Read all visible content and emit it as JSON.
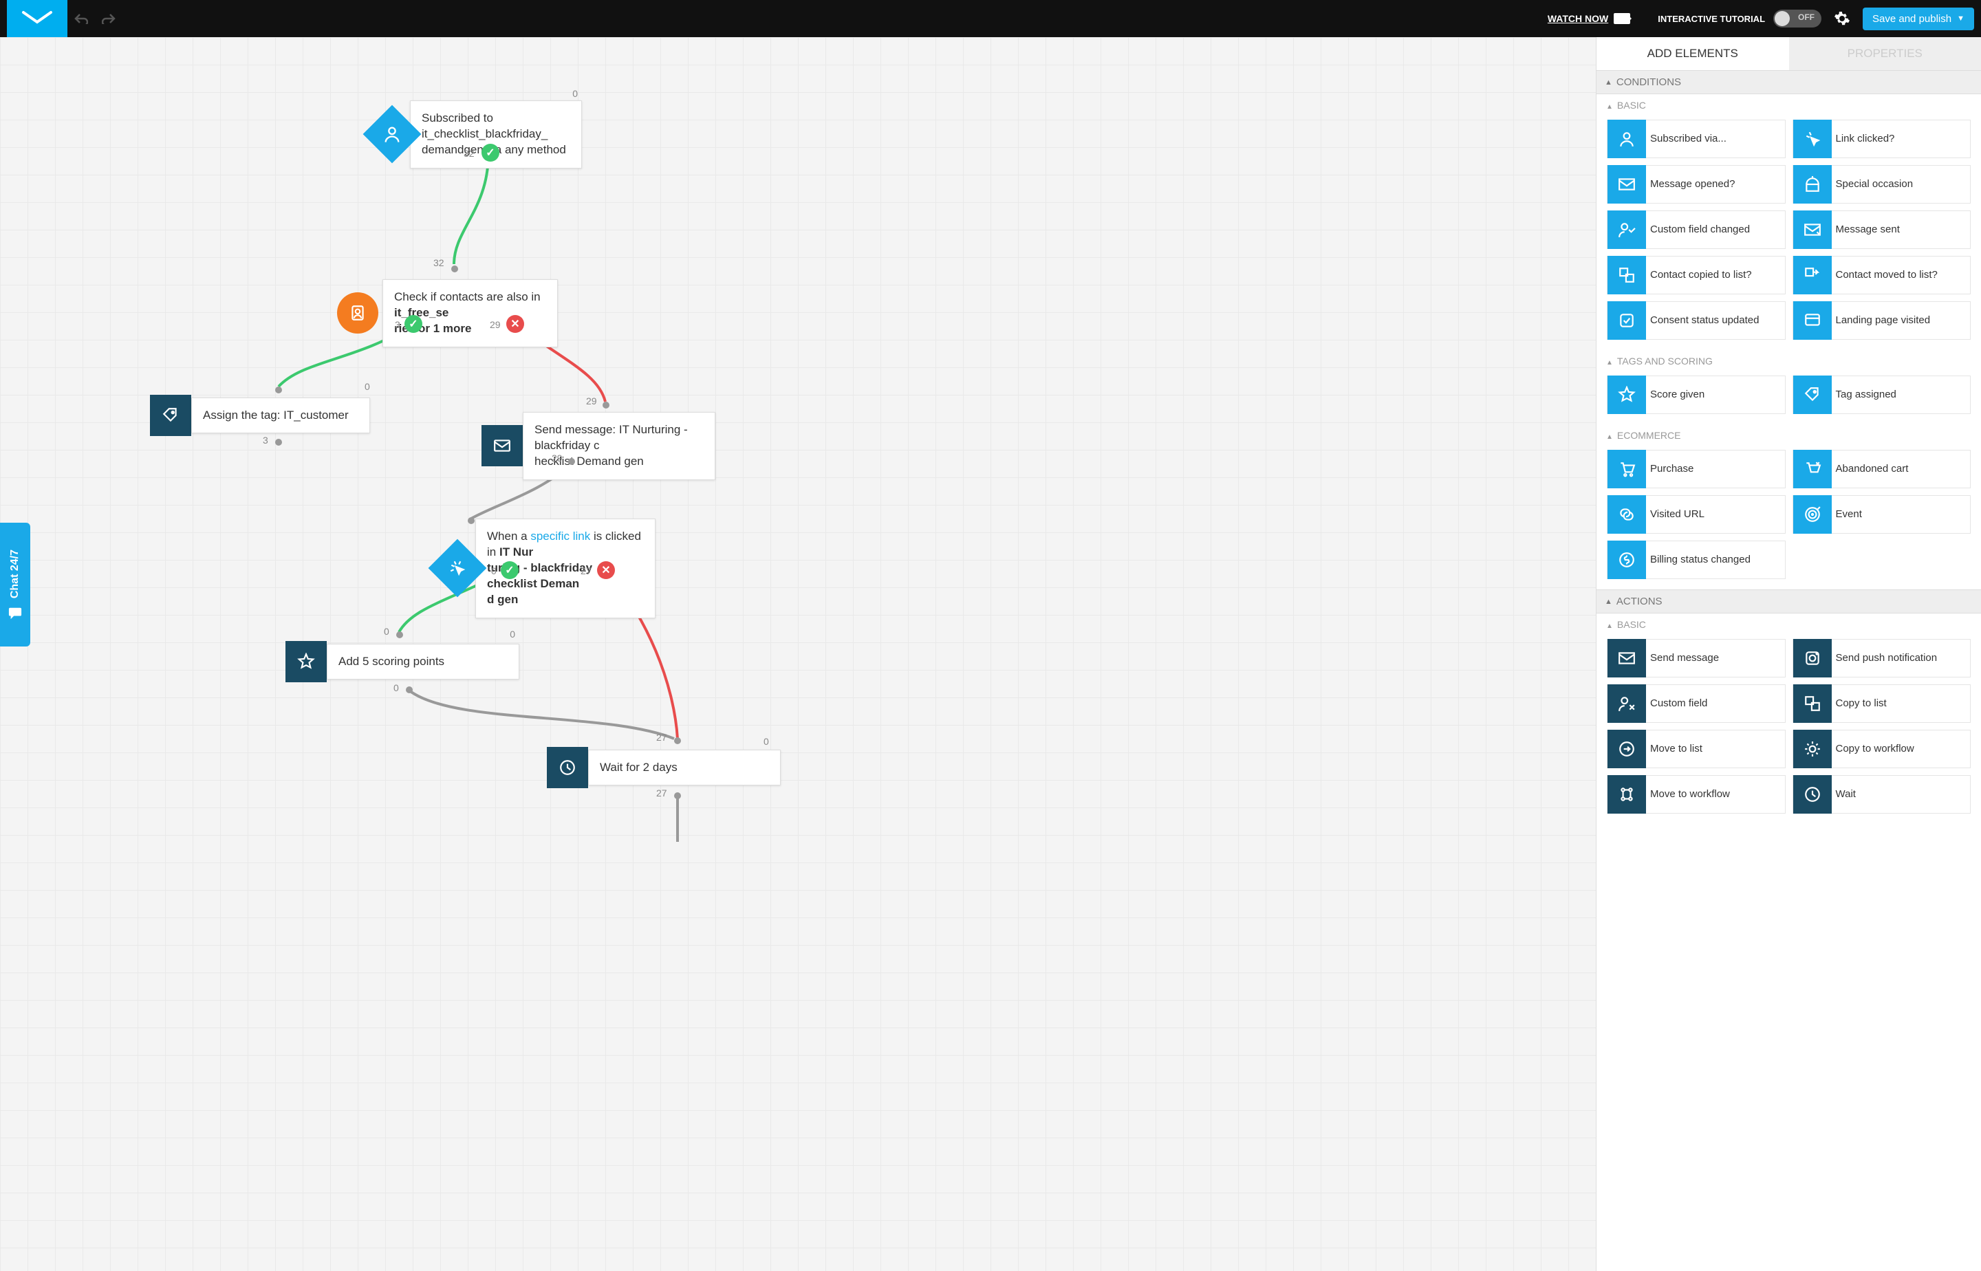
{
  "header": {
    "watch_now": "WATCH NOW",
    "tutorial": "INTERACTIVE TUTORIAL",
    "toggle_label": "OFF",
    "save_label": "Save and publish"
  },
  "chat": {
    "label": "Chat 24/7"
  },
  "nodes": {
    "n1": {
      "text_a": "Subscribed to it_checklist_blackfriday_",
      "text_b": "demandgen via any method",
      "top": "0",
      "bottom": "32"
    },
    "n2": {
      "text_a": "Check if contacts are also in ",
      "bold": "it_free_se",
      "text_b": "ries or 1 more",
      "top": "32",
      "left": "3",
      "right": "29"
    },
    "n3": {
      "text": "Assign the tag: IT_customer",
      "top": "0",
      "bottom": "3"
    },
    "n4": {
      "text_a": "Send message: IT Nurturing - blackfriday c",
      "text_b": "hecklist Demand gen",
      "top": "29",
      "bottom": "29"
    },
    "n5": {
      "text_a": "When a ",
      "link": "specific link",
      "text_b": " is clicked in ",
      "bold_a": "IT Nur",
      "bold_b": "turing - blackfriday checklist Deman",
      "bold_c": "d gen",
      "left": "0",
      "right": "27"
    },
    "n6": {
      "text": "Add 5 scoring points",
      "top": "0",
      "bottom": "0"
    },
    "n7": {
      "text": "Wait for 2 days",
      "top": "0",
      "bottom": "27"
    },
    "extra_27": "27"
  },
  "sidebar": {
    "tabs": {
      "add": "ADD ELEMENTS",
      "props": "PROPERTIES"
    },
    "sections": {
      "conditions": "CONDITIONS",
      "basic": "BASIC",
      "tags": "TAGS AND SCORING",
      "ecom": "ECOMMERCE",
      "actions": "ACTIONS",
      "basic2": "BASIC"
    },
    "cond_basic": [
      "Subscribed via...",
      "Link clicked?",
      "Message opened?",
      "Special occasion",
      "Custom field changed",
      "Message sent",
      "Contact copied to list?",
      "Contact moved to list?",
      "Consent status updated",
      "Landing page visited"
    ],
    "cond_tags": [
      "Score given",
      "Tag assigned"
    ],
    "cond_ecom": [
      "Purchase",
      "Abandoned cart",
      "Visited URL",
      "Event",
      "Billing status changed"
    ],
    "act_basic": [
      "Send message",
      "Send push notification",
      "Custom field",
      "Copy to list",
      "Move to list",
      "Copy to workflow",
      "Move to workflow",
      "Wait"
    ]
  }
}
